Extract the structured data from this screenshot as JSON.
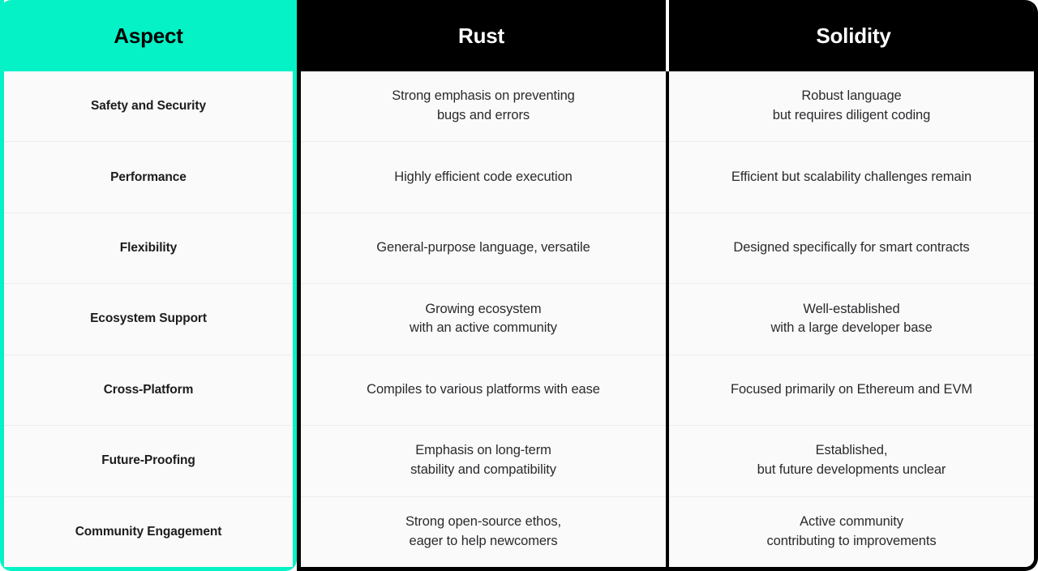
{
  "theme": {
    "accent": "#05f2c7",
    "header_dark": "#000000",
    "cell_bg": "#fafafa",
    "divider": "#ededed",
    "header_text_light": "#ffffff",
    "header_text_dark": "#000000",
    "body_text": "#2b2b2f"
  },
  "table": {
    "columns": [
      {
        "id": "aspect",
        "label": "Aspect"
      },
      {
        "id": "rust",
        "label": "Rust"
      },
      {
        "id": "solidity",
        "label": "Solidity"
      }
    ],
    "rows": [
      {
        "aspect": "Safety and Security",
        "rust": "Strong emphasis on preventing\nbugs and errors",
        "solidity": "Robust language\nbut requires diligent coding"
      },
      {
        "aspect": "Performance",
        "rust": "Highly efficient code execution",
        "solidity": "Efficient but scalability challenges remain"
      },
      {
        "aspect": "Flexibility",
        "rust": "General-purpose language, versatile",
        "solidity": "Designed specifically for smart contracts"
      },
      {
        "aspect": "Ecosystem Support",
        "rust": "Growing ecosystem\nwith an active community",
        "solidity": "Well-established\nwith a large developer base"
      },
      {
        "aspect": "Cross-Platform",
        "rust": "Compiles to various platforms with ease",
        "solidity": "Focused primarily on Ethereum and EVM"
      },
      {
        "aspect": "Future-Proofing",
        "rust": "Emphasis on long-term\nstability and compatibility",
        "solidity": "Established,\nbut future developments unclear"
      },
      {
        "aspect": "Community Engagement",
        "rust": "Strong open-source ethos,\neager to help newcomers",
        "solidity": "Active community\ncontributing to improvements"
      }
    ]
  }
}
